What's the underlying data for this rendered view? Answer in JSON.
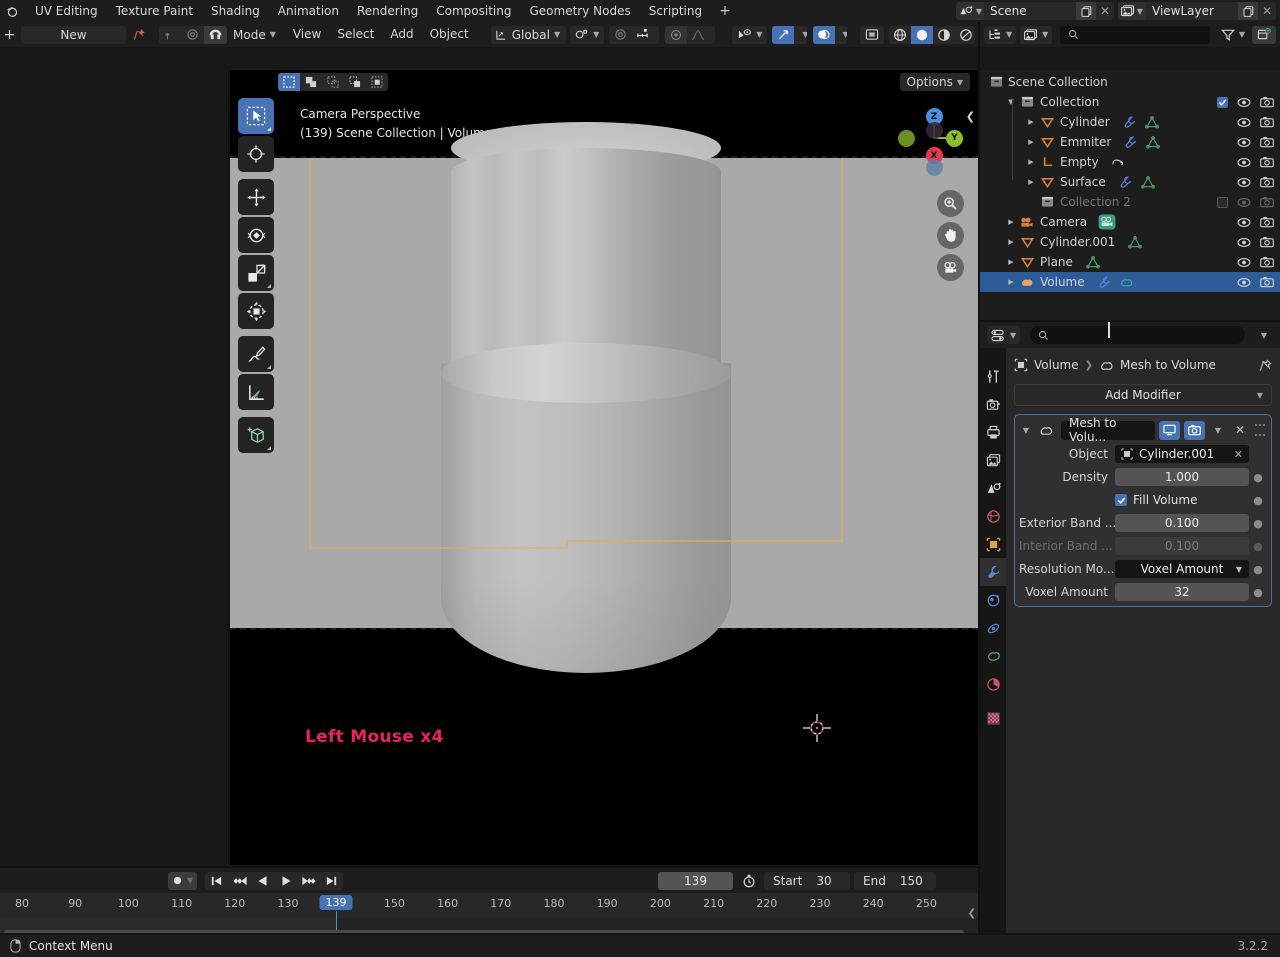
{
  "topbar": {
    "workspaces": [
      "UV Editing",
      "Texture Paint",
      "Shading",
      "Animation",
      "Rendering",
      "Compositing",
      "Geometry Nodes",
      "Scripting"
    ],
    "add_workspace": "+",
    "scene": {
      "label": "Scene",
      "icon": "scene-icon"
    },
    "viewlayer": {
      "label": "ViewLayer",
      "icon": "viewlayer-icon"
    }
  },
  "filebar": {
    "add": "+",
    "new_label": "New",
    "pin_icon": "pin-icon"
  },
  "viewport_header": {
    "mode": "Mode",
    "menus": [
      "View",
      "Select",
      "Add",
      "Object"
    ],
    "transform_orientation": "Global",
    "options_label": "Options"
  },
  "viewport": {
    "line1": "Camera Perspective",
    "line2": "(139) Scene Collection | Volume",
    "gizmo_axes": [
      "Z",
      "Y",
      "X"
    ],
    "tools": [
      "tweak-select-tool",
      "cursor-tool",
      "move-tool",
      "rotate-tool",
      "scale-tool",
      "transform-tool",
      "annotate-tool",
      "measure-tool",
      "add-cube-tool"
    ]
  },
  "overlay": {
    "input_log": "Left Mouse x4"
  },
  "outliner": {
    "search_placeholder": "",
    "root": "Scene Collection",
    "rows": [
      {
        "label": "Collection",
        "indent": 1,
        "type": "collection",
        "expanded": true,
        "checkbox": true,
        "eye": true,
        "camera": true,
        "disabled": false,
        "selected": false,
        "arrow": "down",
        "badges": []
      },
      {
        "label": "Cylinder",
        "indent": 2,
        "type": "mesh",
        "expanded": false,
        "checkbox": null,
        "eye": true,
        "camera": true,
        "disabled": false,
        "selected": false,
        "arrow": "right",
        "badges": [
          "modifier",
          "mesh-data"
        ]
      },
      {
        "label": "Emmiter",
        "indent": 2,
        "type": "mesh",
        "expanded": false,
        "checkbox": null,
        "eye": true,
        "camera": true,
        "disabled": false,
        "selected": false,
        "arrow": "right",
        "badges": [
          "modifier",
          "mesh-data"
        ]
      },
      {
        "label": "Empty",
        "indent": 2,
        "type": "empty",
        "expanded": false,
        "checkbox": null,
        "eye": true,
        "camera": true,
        "disabled": false,
        "selected": false,
        "arrow": "right",
        "badges": [
          "constraint"
        ]
      },
      {
        "label": "Surface",
        "indent": 2,
        "type": "mesh",
        "expanded": false,
        "checkbox": null,
        "eye": true,
        "camera": true,
        "disabled": false,
        "selected": false,
        "arrow": "right",
        "badges": [
          "modifier",
          "mesh-data"
        ]
      },
      {
        "label": "Collection 2",
        "indent": 2,
        "type": "collection",
        "expanded": false,
        "checkbox": false,
        "eye": true,
        "camera": true,
        "disabled": true,
        "selected": false,
        "arrow": "none",
        "badges": []
      },
      {
        "label": "Camera",
        "indent": 1,
        "type": "camera",
        "expanded": false,
        "checkbox": null,
        "eye": true,
        "camera": true,
        "disabled": false,
        "selected": false,
        "arrow": "right",
        "badges": [
          "camera-data"
        ]
      },
      {
        "label": "Cylinder.001",
        "indent": 1,
        "type": "mesh",
        "expanded": false,
        "checkbox": null,
        "eye": true,
        "camera": true,
        "disabled": false,
        "selected": false,
        "arrow": "right",
        "badges": [
          "mesh-data"
        ]
      },
      {
        "label": "Plane",
        "indent": 1,
        "type": "mesh",
        "expanded": false,
        "checkbox": null,
        "eye": true,
        "camera": true,
        "disabled": false,
        "selected": false,
        "arrow": "right",
        "badges": [
          "mesh-data"
        ]
      },
      {
        "label": "Volume",
        "indent": 1,
        "type": "volume",
        "expanded": false,
        "checkbox": null,
        "eye": true,
        "camera": true,
        "disabled": false,
        "selected": true,
        "arrow": "right",
        "badges": [
          "modifier",
          "volume-data"
        ]
      }
    ]
  },
  "properties": {
    "search_placeholder": "",
    "breadcrumb": [
      "Volume",
      "Mesh to Volume"
    ],
    "add_modifier_label": "Add Modifier",
    "modifier": {
      "name": "Mesh to Volu...",
      "display_toggles": [
        "realtime-display-toggle",
        "render-display-toggle"
      ],
      "fields": [
        {
          "label": "Object",
          "value": "Cylinder.001",
          "type": "object",
          "disabled": false,
          "has_dot": false
        },
        {
          "label": "Density",
          "value": "1.000",
          "type": "number",
          "disabled": false,
          "has_dot": true
        },
        {
          "label": "Fill Volume",
          "value": "Fill Volume",
          "type": "checkbox",
          "checked": true,
          "disabled": false,
          "has_dot": true
        },
        {
          "label": "Exterior Band ...",
          "value": "0.100",
          "type": "number",
          "disabled": false,
          "has_dot": true
        },
        {
          "label": "Interior Band ...",
          "value": "0.100",
          "type": "number",
          "disabled": true,
          "has_dot": true
        },
        {
          "label": "Resolution Mo...",
          "value": "Voxel Amount",
          "type": "dropdown",
          "disabled": false,
          "has_dot": true
        },
        {
          "label": "Voxel Amount",
          "value": "32",
          "type": "number",
          "disabled": false,
          "has_dot": true
        }
      ]
    },
    "tabs": [
      "tool-tab",
      "render-tab",
      "output-tab",
      "viewlayer-tab",
      "scene-tab",
      "world-tab",
      "object-tab",
      "modifier-tab",
      "particles-tab",
      "physics-tab",
      "object-constraint-tab",
      "object-data-tab",
      "material-tab",
      "texture-tab"
    ]
  },
  "timeline": {
    "current_frame": "139",
    "start_label": "Start",
    "start_value": "30",
    "end_label": "End",
    "end_value": "150",
    "ticks": [
      "80",
      "90",
      "100",
      "110",
      "120",
      "130",
      "139",
      "150",
      "160",
      "170",
      "180",
      "190",
      "200",
      "210",
      "220",
      "230",
      "240",
      "250"
    ],
    "playback_buttons": [
      "jump-to-start",
      "jump-to-prev-keyframe",
      "play-reverse",
      "play",
      "jump-to-next-keyframe",
      "jump-to-end"
    ]
  },
  "status": {
    "context_menu_label": "Context Menu",
    "version": "3.2.2"
  },
  "colors": {
    "accent_blue": "#4772b3",
    "selection_blue": "#2d5c99",
    "camera_frame": "#e6a860",
    "overlay_red": "#e8245c",
    "panel_bg": "#1d1d1d",
    "body_bg": "#282828"
  }
}
